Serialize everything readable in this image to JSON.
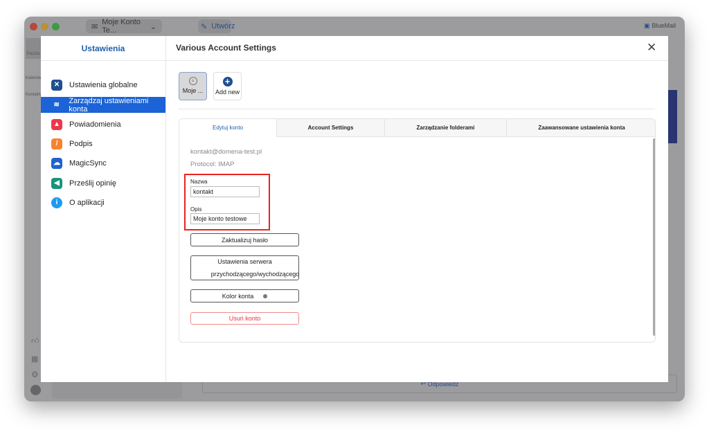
{
  "app": {
    "account_selector": "Moje Konto Te...",
    "compose_label": "Utwórz",
    "brand": "BlueMail",
    "rail": [
      "Poczta",
      "Kalendarz",
      "Kontakty"
    ],
    "reply_label": "Odpowiedz",
    "accent": "#2a3470"
  },
  "settings": {
    "title": "Ustawienia",
    "header": "Various Account Settings",
    "sidebar": [
      {
        "label": "Ustawienia globalne",
        "icon": "tools-icon",
        "color": "#1f4f8f"
      },
      {
        "label": "Zarządzaj ustawieniami konta",
        "icon": "layers-icon",
        "active": true
      },
      {
        "label": "Powiadomienia",
        "icon": "bell-icon",
        "color": "#f0364a"
      },
      {
        "label": "Podpis",
        "icon": "brush-icon",
        "color": "#f7832f"
      },
      {
        "label": "MagicSync",
        "icon": "cloud-sync-icon",
        "color": "#1f63d0"
      },
      {
        "label": "Prześlij opinię",
        "icon": "megaphone-icon",
        "color": "#18957b"
      },
      {
        "label": "O aplikacji",
        "icon": "info-icon",
        "color": "#1d9bf0"
      }
    ],
    "accounts": [
      {
        "label": "Moje ...",
        "selected": true
      },
      {
        "label": "Add new"
      }
    ],
    "tabs": [
      "Edytuj konto",
      "Account Settings",
      "Zarządzanie folderami",
      "Zaawansowane ustawienia konta"
    ],
    "active_tab": 0,
    "email": "kontakt@domena-test.pl",
    "protocol": "Protocol: IMAP",
    "name_label": "Nazwa",
    "name_value": "kontakt",
    "desc_label": "Opis",
    "desc_value": "Moje konto testowe",
    "buttons": {
      "update_password": "Zaktualizuj hasło",
      "server_line1": "Ustawienia serwera",
      "server_line2": "przychodzącego/wychodzącego",
      "color": "Kolor konta",
      "delete": "Usuń konto"
    }
  }
}
